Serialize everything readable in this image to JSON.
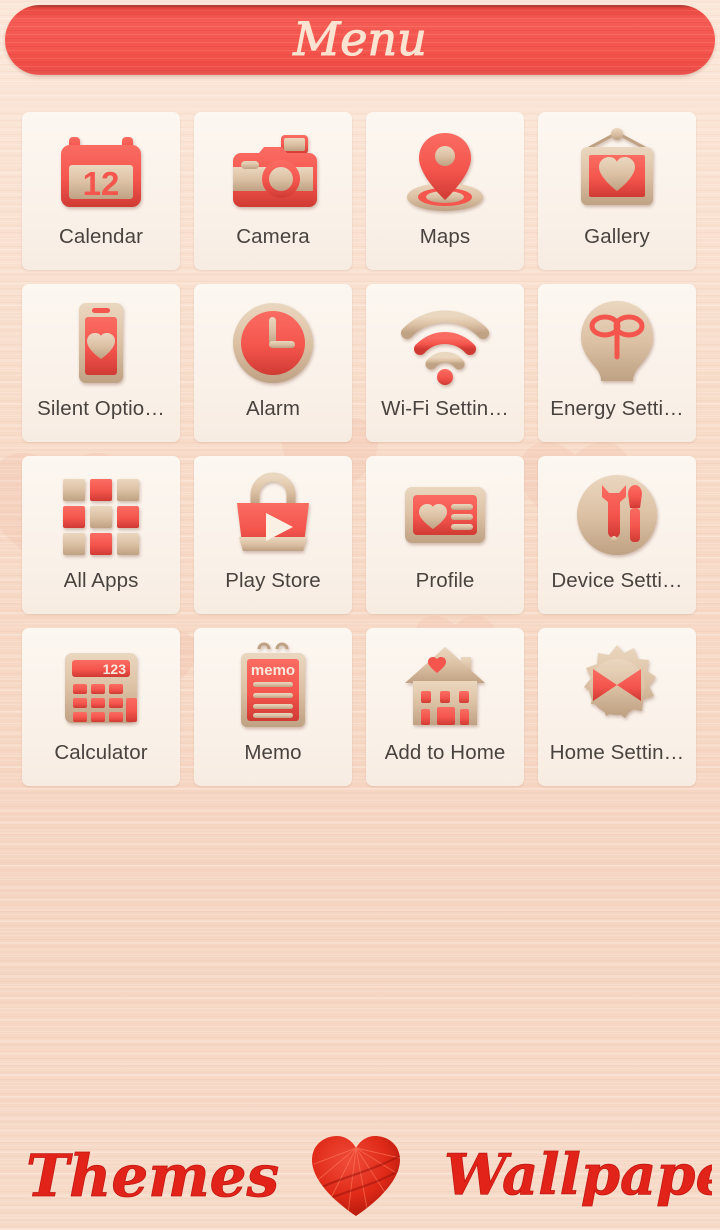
{
  "header": {
    "title": "Menu",
    "bar_color": "#f4554d",
    "title_color": "#fbe3d2"
  },
  "theme": {
    "background_color": "#f8ddcb",
    "tile_color": "#faf2ea",
    "accent_red": "#f4554d",
    "wood_color": "#d8bea3",
    "label_color": "#494340"
  },
  "apps": [
    {
      "label": "Calendar",
      "icon": "calendar-icon",
      "badge": "12"
    },
    {
      "label": "Camera",
      "icon": "camera-icon",
      "badge": ""
    },
    {
      "label": "Maps",
      "icon": "map-pin-icon",
      "badge": ""
    },
    {
      "label": "Gallery",
      "icon": "picture-frame-icon",
      "badge": ""
    },
    {
      "label": "Silent Optio…",
      "icon": "phone-heart-icon",
      "badge": ""
    },
    {
      "label": "Alarm",
      "icon": "clock-icon",
      "badge": ""
    },
    {
      "label": "Wi-Fi Settin…",
      "icon": "wifi-icon",
      "badge": ""
    },
    {
      "label": "Energy Setti…",
      "icon": "lightbulb-icon",
      "badge": ""
    },
    {
      "label": "All Apps",
      "icon": "grid-apps-icon",
      "badge": ""
    },
    {
      "label": "Play Store",
      "icon": "shopping-bag-play-icon",
      "badge": ""
    },
    {
      "label": "Profile",
      "icon": "profile-card-icon",
      "badge": ""
    },
    {
      "label": "Device Setti…",
      "icon": "wrench-screwdriver-icon",
      "badge": ""
    },
    {
      "label": "Calculator",
      "icon": "calculator-icon",
      "badge": "123"
    },
    {
      "label": "Memo",
      "icon": "memo-icon",
      "badge": "memo"
    },
    {
      "label": "Add to Home",
      "icon": "house-heart-icon",
      "badge": ""
    },
    {
      "label": "Home Settin…",
      "icon": "gear-bow-icon",
      "badge": ""
    }
  ],
  "footer": {
    "themes_label": "Themes",
    "heart_icon": "yarn-heart-icon",
    "wallpapers_label": "Wallpapers",
    "script_color": "#e2231a"
  }
}
